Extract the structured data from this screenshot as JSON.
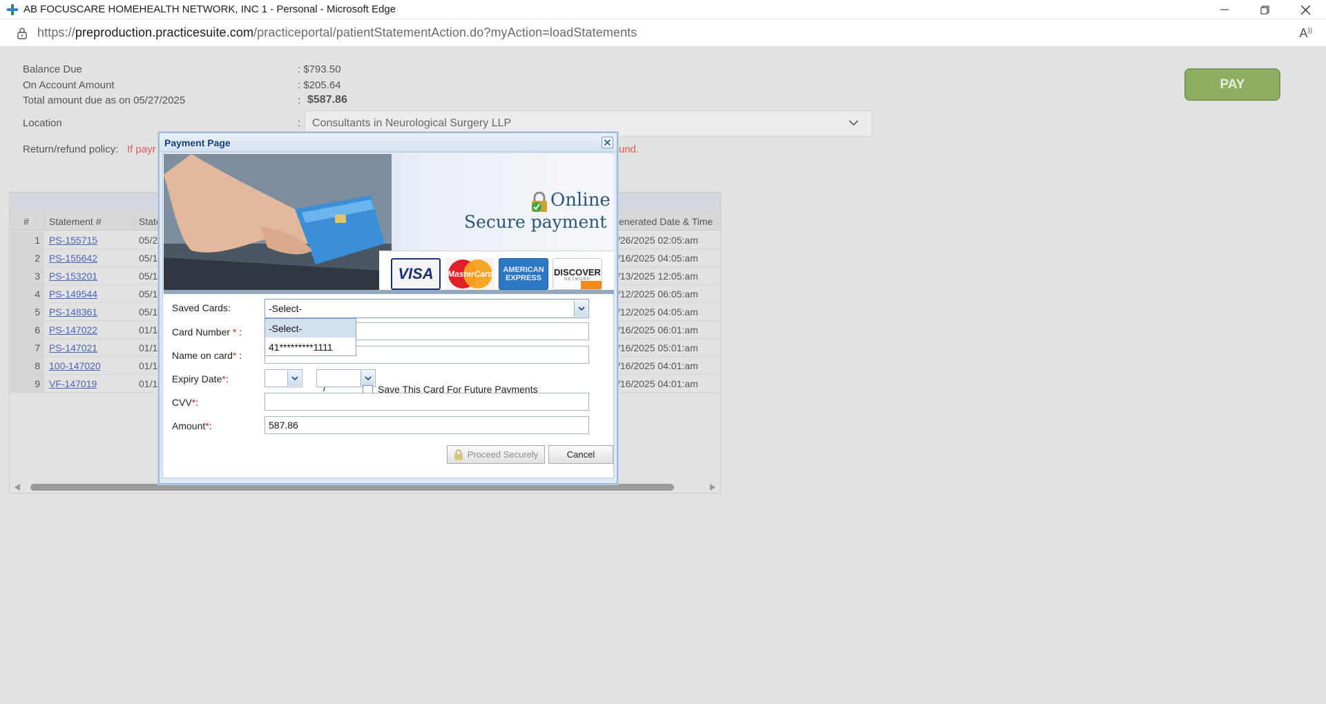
{
  "browser": {
    "title": "AB FOCUSCARE HOMEHEALTH NETWORK, INC 1 - Personal - Microsoft Edge",
    "url_prefix": "https://",
    "url_host": "preproduction.practicesuite.com",
    "url_path": "/practiceportal/patientStatementAction.do?myAction=loadStatements"
  },
  "summary": {
    "balance_label": "Balance Due",
    "balance_value": ": $793.50",
    "on_account_label": "On Account Amount",
    "on_account_value": ": $205.64",
    "total_label": "Total amount due as on 05/27/2025",
    "total_colon": ":",
    "total_value": "$587.86",
    "location_label": "Location",
    "location_colon": ":",
    "location_value": "Consultants in Neurological Surgery LLP",
    "policy_label": "Return/refund policy:",
    "policy_text_start": "If payr",
    "policy_text_end": "und."
  },
  "pay_button": "PAY",
  "grid": {
    "headers": [
      "#",
      "Statement #",
      "State",
      "enerated Date & Time"
    ],
    "rows": [
      {
        "num": "1",
        "statement": "PS-155715",
        "date": "05/2",
        "generated": "/26/2025 02:05:am"
      },
      {
        "num": "2",
        "statement": "PS-155642",
        "date": "05/1",
        "generated": "/16/2025 04:05:am"
      },
      {
        "num": "3",
        "statement": "PS-153201",
        "date": "05/1",
        "generated": "/13/2025 12:05:am"
      },
      {
        "num": "4",
        "statement": "PS-149544",
        "date": "05/1",
        "generated": "/12/2025 06:05:am"
      },
      {
        "num": "5",
        "statement": "PS-148361",
        "date": "05/1",
        "generated": "/12/2025 04:05:am"
      },
      {
        "num": "6",
        "statement": "PS-147022",
        "date": "01/1",
        "generated": "/16/2025 06:01:am"
      },
      {
        "num": "7",
        "statement": "PS-147021",
        "date": "01/1",
        "generated": "/16/2025 05:01:am"
      },
      {
        "num": "8",
        "statement": "100-147020",
        "date": "01/1",
        "generated": "/16/2025 04:01:am"
      },
      {
        "num": "9",
        "statement": "VF-147019",
        "date": "01/1",
        "generated": "/16/2025 04:01:am"
      }
    ]
  },
  "modal": {
    "title": "Payment Page",
    "banner_online": "Online",
    "banner_secure": "Secure payment",
    "cards": {
      "visa": "VISA",
      "mastercard": "MasterCard",
      "amex_line1": "AMERICAN",
      "amex_line2": "EXPRESS",
      "discover": "DISCOVER",
      "discover_sub": "NETWORK"
    },
    "saved_cards_label": "Saved Cards:",
    "saved_cards_value": "-Select-",
    "dropdown_options": [
      "-Select-",
      "41*********1111"
    ],
    "card_number_label": "Card Number",
    "card_number_suffix": " :",
    "name_label": "Name on card",
    "name_suffix": " :",
    "expiry_label": "Expiry Date",
    "expiry_suffix": ":",
    "slash": "/",
    "save_card_label": "Save This Card For Future Payments",
    "cvv_label": "CVV",
    "cvv_suffix": ":",
    "amount_label": "Amount",
    "amount_suffix": ":",
    "amount_value": "587.86",
    "required_mark": "*",
    "proceed_button": "Proceed Securely",
    "cancel_button": "Cancel"
  },
  "colors": {
    "pay_button": "#8fae62",
    "link": "#4a64b8",
    "policy_text": "#d95a5a",
    "modal_title": "#163f7a",
    "required": "#d92020"
  }
}
